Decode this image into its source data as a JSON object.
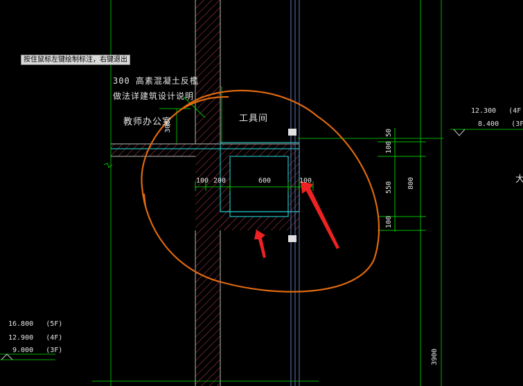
{
  "status_prompt": "按住鼠标左键绘制标注，右键退出",
  "notes": {
    "line1": "300  高素混凝土反檻",
    "line2": "做法详建筑设计说明"
  },
  "rooms": {
    "office": "教师办公室",
    "tool_room": "工具间"
  },
  "dims_horizontal": [
    "100",
    "200",
    "600",
    "100"
  ],
  "dims_left_vertical": "300",
  "dims_right_vertical": {
    "top": "50",
    "d1": "100",
    "d2": "550",
    "d3": "100",
    "total": "800"
  },
  "levels_top_right": [
    {
      "elev": "12.300",
      "floor": "(4F"
    },
    {
      "elev": "8.400",
      "floor": "(3F"
    }
  ],
  "levels_bottom_left": [
    {
      "elev": "16.800",
      "floor": "(5F)"
    },
    {
      "elev": "12.900",
      "floor": "(4F)"
    },
    {
      "elev": "9.000",
      "floor": "(3F)"
    }
  ],
  "bottom_dim": "3900",
  "edge_char": "大",
  "colors": {
    "background": "#000000",
    "green": "#00c000",
    "cyan": "#20c0c0",
    "hatch": "#cc3344",
    "markup_orange": "#e06a10",
    "markup_red": "#ee2222"
  }
}
